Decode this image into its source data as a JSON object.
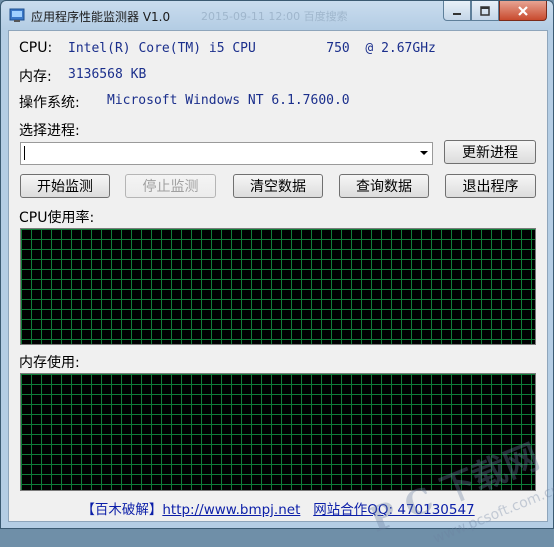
{
  "window": {
    "title": "应用程序性能监测器 V1.0",
    "ghost_title": "2015-09-11 12:00  百度搜索",
    "colors": {
      "accent": "#1b2f8c",
      "grid_line": "#0f7d38",
      "grid_bg": "#000000",
      "close": "#c84a2e"
    }
  },
  "info": {
    "cpu_label": "CPU:",
    "cpu_value": "Intel(R) Core(TM) i5 CPU         750  @ 2.67GHz",
    "mem_label": "内存:",
    "mem_value": "3136568 KB",
    "os_label": "操作系统:",
    "os_value": "Microsoft Windows NT 6.1.7600.0"
  },
  "process": {
    "label": "选择进程:",
    "selected": "",
    "refresh_label": "更新进程"
  },
  "toolbar": {
    "start_label": "开始监测",
    "stop_label": "停止监测",
    "clear_label": "清空数据",
    "query_label": "查询数据",
    "exit_label": "退出程序"
  },
  "graphs": {
    "cpu_label": "CPU使用率:",
    "mem_label": "内存使用:"
  },
  "footer": {
    "brand": "【百木破解】",
    "url": "http://www.bmpj.net",
    "contact": "网站合作QQ: 470130547"
  },
  "watermark": {
    "text": "P C 下载网",
    "sub": "www.pcsoft.com.cn"
  }
}
